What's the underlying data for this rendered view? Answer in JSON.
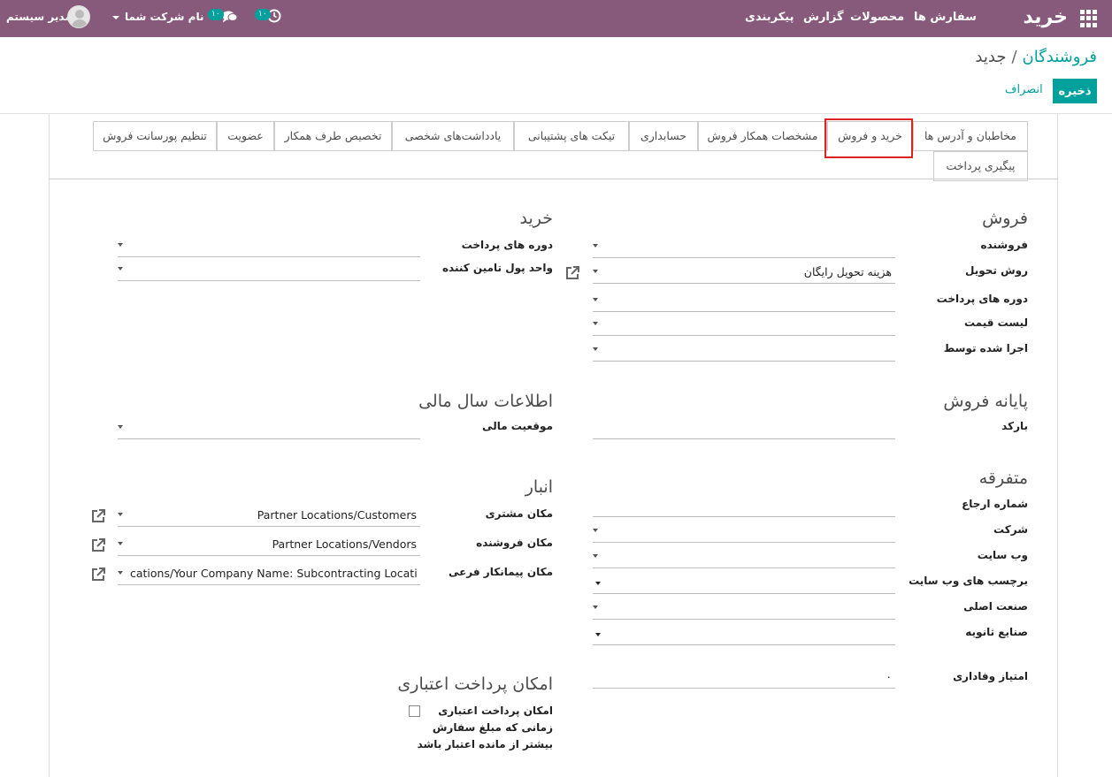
{
  "topbar": {
    "brand": "خرید",
    "menu": [
      "سفارش ها",
      "محصولات",
      "گزارش",
      "پیکربندی"
    ],
    "user": "مدیر سیستم",
    "company": "نام شرکت شما",
    "activity_count": "۱۰",
    "messages_count": "۱۰"
  },
  "breadcrumb": {
    "parent": "فروشندگان",
    "current": "جدید"
  },
  "buttons": {
    "save": "ذخیره",
    "discard": "انصراف"
  },
  "tabs": [
    "مخاطبان و آدرس ها",
    "خرید و فروش",
    "مشخصات همکار فروش",
    "حسابداری",
    "تیکت های پشتیبانی",
    "یادداشت‌های شخصی",
    "تخصیص طرف همکار",
    "عضویت",
    "تنظیم پورسانت فروش",
    "پیگیری پرداخت"
  ],
  "sales": {
    "title": "فروش",
    "labels": [
      "فروشنده",
      "روش تحویل",
      "دوره های پرداخت",
      "لیست قیمت",
      "اجرا شده توسط"
    ],
    "delivery_value": "هزینه تحویل رایگان"
  },
  "purchase": {
    "title": "خرید",
    "labels": [
      "دوره های پرداخت",
      "واحد پول تامین کننده"
    ]
  },
  "pos": {
    "title": "پایانه فروش",
    "barcode": "بارکد"
  },
  "fiscal": {
    "title": "اطلاعات سال مالی",
    "position": "موقعیت مالی"
  },
  "misc": {
    "title": "متفرقه",
    "labels": [
      "شماره ارجاع",
      "شرکت",
      "وب سایت",
      "برچسب های وب سایت",
      "صنعت اصلی",
      "صنایع ثانویه"
    ],
    "loyalty_label": "امتیاز وفاداری",
    "loyalty_value": "۰"
  },
  "stock": {
    "title": "انبار",
    "labels": [
      "مکان مشتری",
      "مکان فروشنده",
      "مکان پیمانکار فرعی"
    ],
    "values": [
      "Partner Locations/Customers",
      "Partner Locations/Vendors",
      "cations/Your Company Name: Subcontracting Location"
    ]
  },
  "credit": {
    "title": "امکان پرداخت اعتباری",
    "label_lines": [
      "امکان پرداخت اعتباری",
      "زمانی که مبلغ سفارش",
      "بیشتر از مانده اعتبار باشد"
    ]
  }
}
